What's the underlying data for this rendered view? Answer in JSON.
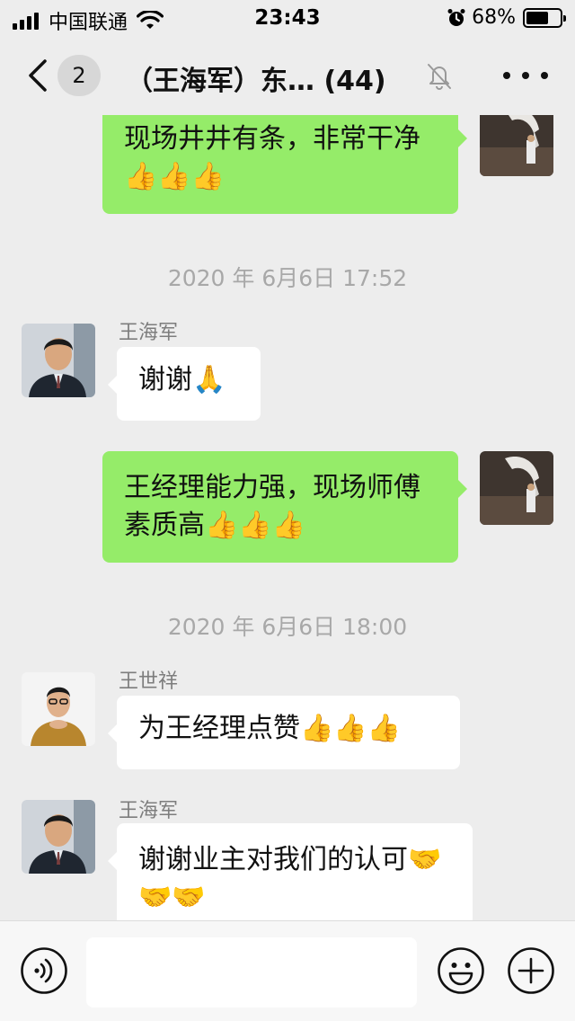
{
  "status_bar": {
    "carrier": "中国联通",
    "time": "23:43",
    "battery_percent": "68%",
    "battery_level": 0.68
  },
  "nav": {
    "unread_count": "2",
    "title": "（王海军）东… (44)"
  },
  "messages": [
    {
      "type": "text",
      "side": "right",
      "text": "现场井井有条，非常干净👍👍👍"
    },
    {
      "type": "timestamp",
      "text": "2020 年 6月6日 17:52"
    },
    {
      "type": "text",
      "side": "left",
      "sender": "王海军",
      "text": "谢谢🙏"
    },
    {
      "type": "text",
      "side": "right",
      "text": "王经理能力强，现场师傅素质高👍👍👍"
    },
    {
      "type": "timestamp",
      "text": "2020 年 6月6日 18:00"
    },
    {
      "type": "text",
      "side": "left",
      "sender": "王世祥",
      "text": "为王经理点赞👍👍👍"
    },
    {
      "type": "text",
      "side": "left",
      "sender": "王海军",
      "text": "谢谢业主对我们的认可🤝🤝🤝"
    }
  ],
  "input": {
    "value": "",
    "placeholder": ""
  },
  "icons": {
    "back": "chevron-left-icon",
    "mute": "bell-slash-icon",
    "more": "more-dots-icon",
    "voice": "voice-icon",
    "emoji": "smiley-icon",
    "plus": "plus-icon"
  },
  "colors": {
    "background": "#ededed",
    "bubble_self": "#95ec69",
    "bubble_other": "#ffffff",
    "timestamp": "#a8a8a8"
  }
}
